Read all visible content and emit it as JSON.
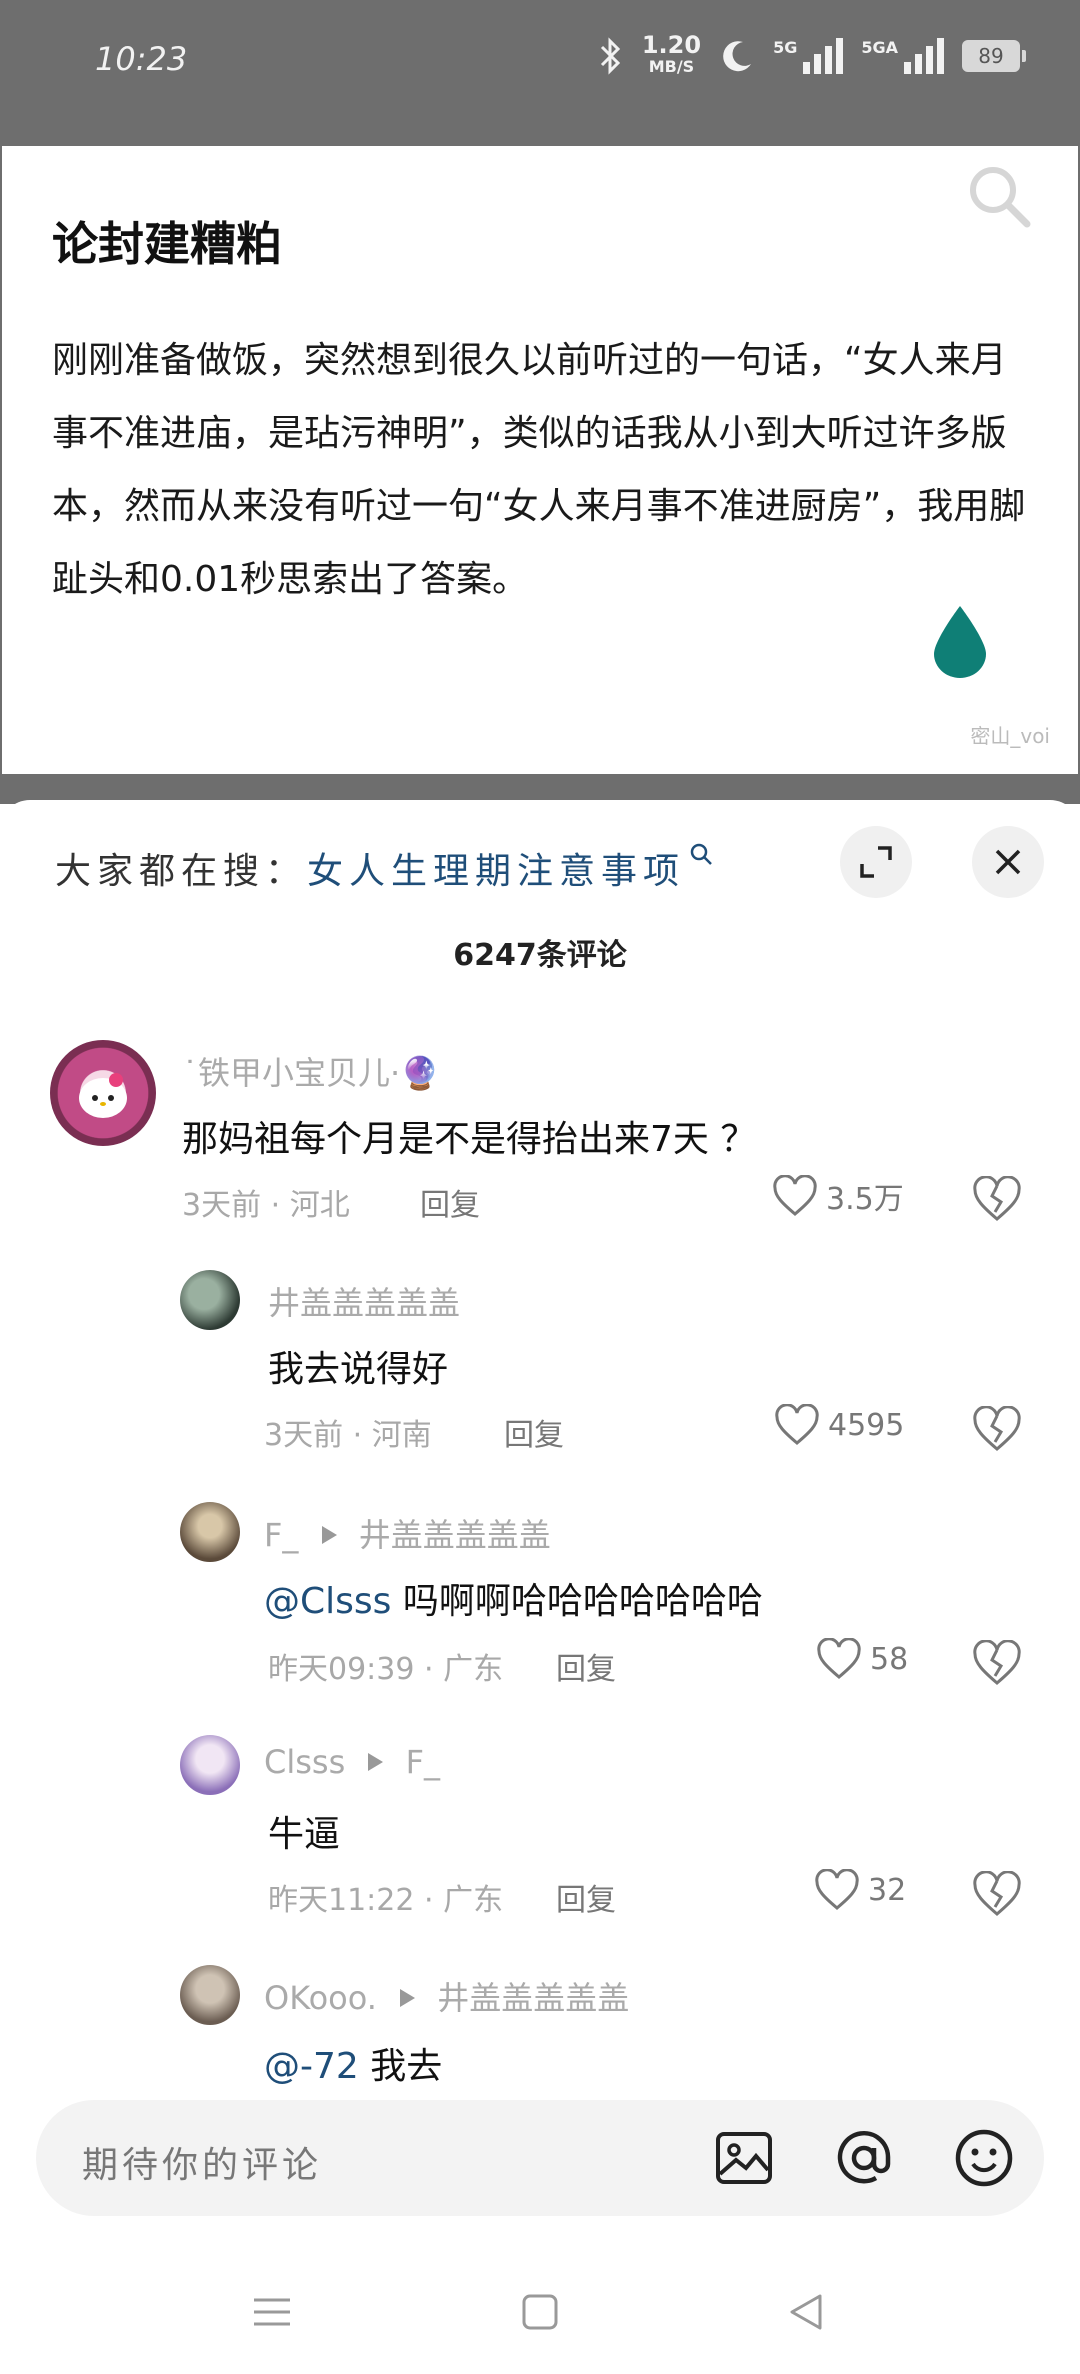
{
  "status_bar": {
    "time": "10:23",
    "net_speed": "1.20",
    "net_unit": "MB/S",
    "sim1": "5G",
    "sim2": "5GA",
    "battery": "89"
  },
  "post": {
    "title": "论封建糟粕",
    "body": "刚刚准备做饭，突然想到很久以前听过的一句话，“女人来月事不准进庙，是玷污神明”，类似的话我从小到大听过许多版本，然而从来没有听过一句“女人来月事不准进厨房”，我用脚趾头和0.01秒思索出了答案。",
    "watermark": "密山_voi"
  },
  "sheet": {
    "search_prefix": "大家都在搜：",
    "search_query": "女人生理期注意事项",
    "comment_count": "6247条评论"
  },
  "comments": [
    {
      "user": "˙铁甲小宝贝儿·🔮",
      "text": "那妈祖每个月是不是得抬出来7天 ？",
      "time": "3天前",
      "location": "河北",
      "reply": "回复",
      "likes": "3.5万"
    },
    {
      "user": "井盖盖盖盖盖",
      "text": "我去说得好",
      "time": "3天前",
      "location": "河南",
      "reply": "回复",
      "likes": "4595"
    },
    {
      "user": "F_",
      "reply_to": "井盖盖盖盖盖",
      "mention": "@Clsss",
      "text": "吗啊啊哈哈哈哈哈哈哈",
      "time": "昨天09:39",
      "location": "广东",
      "reply": "回复",
      "likes": "58"
    },
    {
      "user": "Clsss",
      "reply_to": "F_",
      "text": "牛逼",
      "time": "昨天11:22",
      "location": "广东",
      "reply": "回复",
      "likes": "32"
    },
    {
      "user": "OKooo.",
      "reply_to": "井盖盖盖盖盖",
      "mention": "@-72",
      "text": "我去"
    }
  ],
  "input": {
    "placeholder": "期待你的评论"
  }
}
